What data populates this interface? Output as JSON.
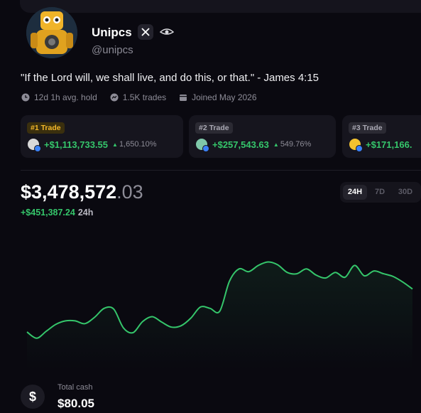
{
  "profile": {
    "name": "Unipcs",
    "handle": "@unipcs",
    "bio": "\"If the Lord will, we shall live, and do this, or that.\" - James 4:15",
    "stats": [
      {
        "icon": "clock-icon",
        "label": "12d 1h avg. hold"
      },
      {
        "icon": "trades-icon",
        "label": "1.5K trades"
      },
      {
        "icon": "calendar-icon",
        "label": "Joined May 2026"
      }
    ]
  },
  "top_trades": [
    {
      "badge": "#1 Trade",
      "profit": "+$1,113,733.55",
      "pct": "1,650.10%",
      "token_color": "#d9d9d9"
    },
    {
      "badge": "#2 Trade",
      "profit": "+$257,543.63",
      "pct": "549.76%",
      "token_color": "#7fc8a9"
    },
    {
      "badge": "#3 Trade",
      "profit": "+$171,166.",
      "pct": "",
      "token_color": "#f2c230"
    }
  ],
  "portfolio": {
    "value_main": "$3,478,572",
    "value_cents": ".03",
    "change": "+$451,387.24",
    "change_period": "24h",
    "ranges": [
      "24H",
      "7D",
      "30D"
    ],
    "selected_range": "24H"
  },
  "chart_data": {
    "type": "area",
    "title": "",
    "xlabel": "",
    "ylabel": "",
    "color": "#35c66b",
    "y": [
      40,
      31,
      41,
      51,
      56,
      56,
      52,
      61,
      74,
      73,
      46,
      39,
      55,
      62,
      54,
      47,
      49,
      60,
      76,
      74,
      70,
      113,
      131,
      127,
      136,
      141,
      137,
      126,
      124,
      131,
      122,
      118,
      126,
      119,
      136,
      121,
      128,
      124,
      120,
      112,
      102
    ],
    "ylim": [
      0,
      160
    ]
  },
  "cash": {
    "label": "Total cash",
    "value": "$80.05",
    "symbol": "$"
  },
  "colors": {
    "background": "#0a0910",
    "positive": "#35c66b",
    "gold": "#f5b82a"
  }
}
